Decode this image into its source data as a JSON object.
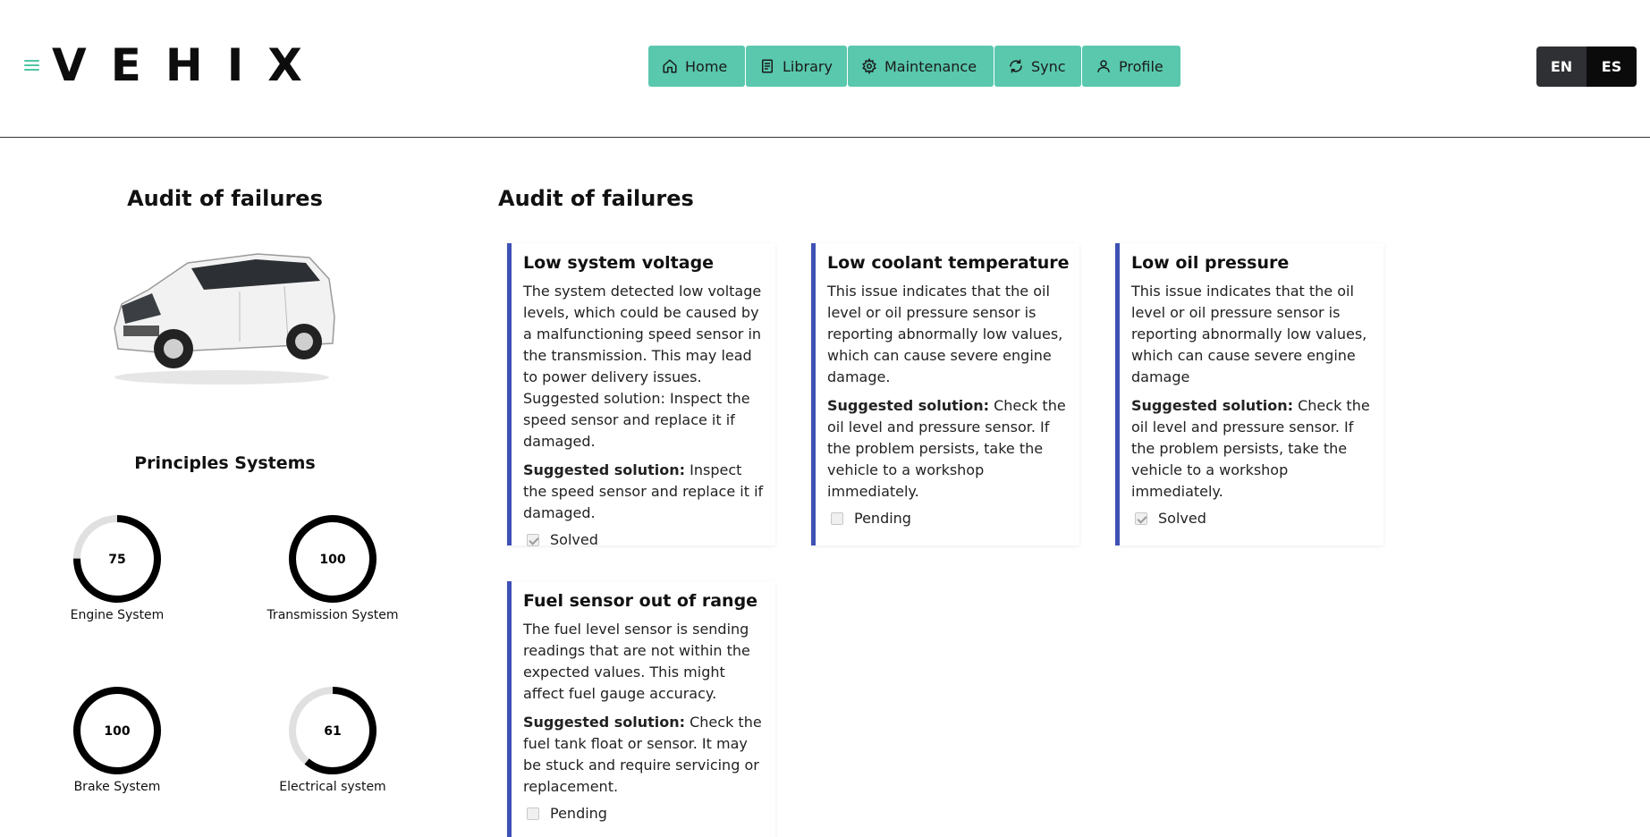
{
  "header": {
    "logo": "VEHIX",
    "nav": [
      {
        "label": "Home",
        "icon": "home-icon"
      },
      {
        "label": "Library",
        "icon": "book-icon"
      },
      {
        "label": "Maintenance",
        "icon": "gear-icon"
      },
      {
        "label": "Sync",
        "icon": "sync-icon"
      },
      {
        "label": "Profile",
        "icon": "user-icon"
      }
    ],
    "languages": [
      "EN",
      "ES"
    ],
    "accent_color": "#59c8ad"
  },
  "left": {
    "title": "Audit of failures",
    "systems_title": "Principles Systems",
    "gauges": [
      {
        "value": "75",
        "label": "Engine System",
        "percent": 75
      },
      {
        "value": "100",
        "label": "Transmission System",
        "percent": 100
      },
      {
        "value": "100",
        "label": "Brake System",
        "percent": 100
      },
      {
        "value": "61",
        "label": "Electrical system",
        "percent": 61
      }
    ]
  },
  "main": {
    "title": "Audit of failures",
    "solution_label": "Suggested solution:",
    "cards": [
      {
        "title": "Low system voltage",
        "description": "The system detected low voltage levels, which could be caused by a malfunctioning speed sensor in the transmission. This may lead to power delivery issues. Suggested solution: Inspect the speed sensor and replace it if damaged.",
        "solution": " Inspect the speed sensor and replace it if damaged.",
        "status": "Solved",
        "checked": true
      },
      {
        "title": "Low coolant temperature",
        "description": "This issue indicates that the oil level or oil pressure sensor is reporting abnormally low values, which can cause severe engine damage.",
        "solution": " Check the oil level and pressure sensor. If the problem persists, take the vehicle to a workshop immediately.",
        "status": "Pending",
        "checked": false
      },
      {
        "title": "Low oil pressure",
        "description": "This issue indicates that the oil level or oil pressure sensor is reporting abnormally low values, which can cause severe engine damage",
        "solution": " Check the oil level and pressure sensor. If the problem persists, take the vehicle to a workshop immediately.",
        "status": "Solved",
        "checked": true
      },
      {
        "title": "Fuel sensor out of range",
        "description": "The fuel level sensor is sending readings that are not within the expected values. This might affect fuel gauge accuracy.",
        "solution": " Check the fuel tank float or sensor. It may be stuck and require servicing or replacement.",
        "status": "Pending",
        "checked": false
      }
    ],
    "card_accent_color": "#3f51b5"
  }
}
